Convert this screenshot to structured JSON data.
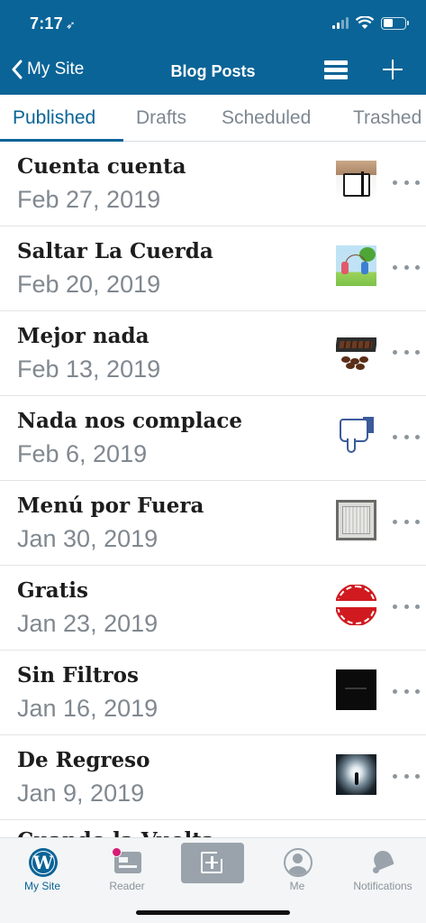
{
  "status_bar": {
    "time": "7:17",
    "location_glyph": "➶"
  },
  "nav": {
    "back_label": "My Site",
    "title": "Blog Posts",
    "list_icon": "list-icon",
    "add_icon": "plus-icon"
  },
  "tabs": [
    {
      "label": "Published",
      "active": true
    },
    {
      "label": "Drafts",
      "active": false
    },
    {
      "label": "Scheduled",
      "active": false
    },
    {
      "label": "Trashed",
      "active": false
    }
  ],
  "posts": [
    {
      "title": "Cuenta cuenta",
      "date": "Feb 27, 2019",
      "thumbnail": "notebook"
    },
    {
      "title": "Saltar La Cuerda",
      "date": "Feb 20, 2019",
      "thumbnail": "kids-jump-rope"
    },
    {
      "title": "Mejor nada",
      "date": "Feb 13, 2019",
      "thumbnail": "chocolate-box"
    },
    {
      "title": "Nada nos complace",
      "date": "Feb 6, 2019",
      "thumbnail": "dislike-thumb"
    },
    {
      "title": "Menú por Fuera",
      "date": "Jan 30, 2019",
      "thumbnail": "picture-frame"
    },
    {
      "title": "Gratis",
      "date": "Jan 23, 2019",
      "thumbnail": "gratis-seal"
    },
    {
      "title": "Sin Filtros",
      "date": "Jan 16, 2019",
      "thumbnail": "black-image"
    },
    {
      "title": "De Regreso",
      "date": "Jan 9, 2019",
      "thumbnail": "tunnel"
    }
  ],
  "partial_post": {
    "title": "Cuando la Vuelta"
  },
  "tab_bar": {
    "items": [
      {
        "label": "My Site",
        "icon": "wordpress-icon",
        "active": true
      },
      {
        "label": "Reader",
        "icon": "reader-icon",
        "active": false
      },
      {
        "label": "",
        "icon": "write-post-icon",
        "active": false
      },
      {
        "label": "Me",
        "icon": "profile-icon",
        "active": false
      },
      {
        "label": "Notifications",
        "icon": "bell-icon",
        "active": false
      }
    ]
  },
  "colors": {
    "brand": "#0a6497",
    "muted": "#808890",
    "badge": "#d81b73"
  }
}
